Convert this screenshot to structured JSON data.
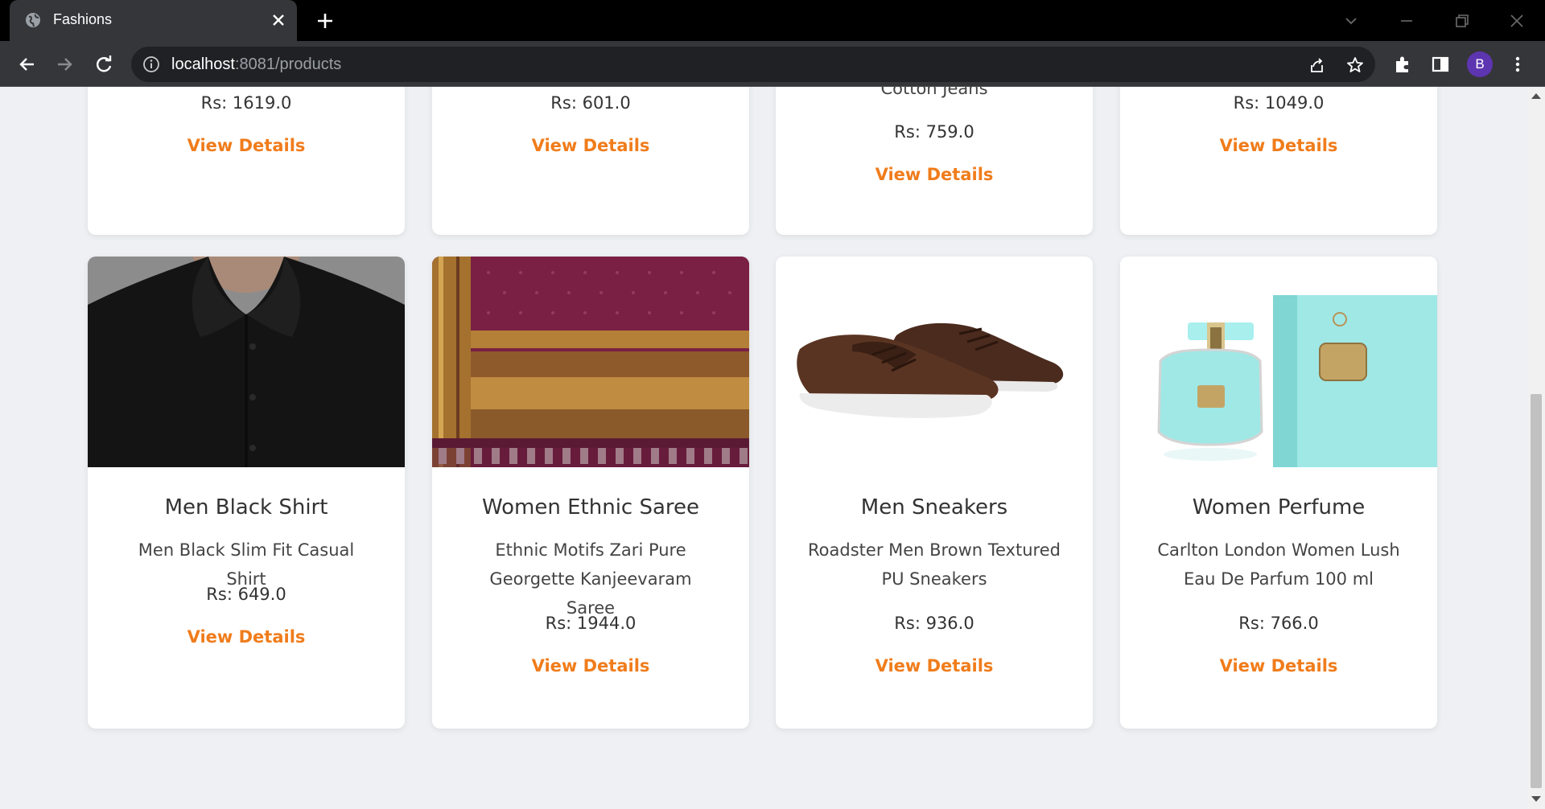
{
  "browser": {
    "tab_title": "Fashions",
    "url_host": "localhost",
    "url_rest": ":8081/products",
    "profile_initial": "B"
  },
  "colors": {
    "accent": "#f07c1b",
    "page_bg": "#eef0f3",
    "card_bg": "#ffffff"
  },
  "top_row": [
    {
      "title": "",
      "description_tail": "",
      "price": "Rs: 1619.0",
      "link": "View Details"
    },
    {
      "title": "",
      "description_tail": "",
      "price": "Rs: 601.0",
      "link": "View Details"
    },
    {
      "title": "",
      "description_tail": "Cotton Jeans",
      "price": "Rs: 759.0",
      "link": "View Details"
    },
    {
      "title": "",
      "description_tail": "",
      "price": "Rs: 1049.0",
      "link": "View Details"
    }
  ],
  "products": [
    {
      "title": "Men Black Shirt",
      "description": "Men Black Slim Fit Casual Shirt",
      "price": "Rs: 649.0",
      "link": "View Details",
      "image": "black-shirt-image"
    },
    {
      "title": "Women Ethnic Saree",
      "description": "Ethnic Motifs Zari Pure Georgette Kanjeevaram Saree",
      "price": "Rs: 1944.0",
      "link": "View Details",
      "image": "saree-image"
    },
    {
      "title": "Men Sneakers",
      "description": "Roadster Men Brown Textured PU Sneakers",
      "price": "Rs: 936.0",
      "link": "View Details",
      "image": "sneakers-image"
    },
    {
      "title": "Women Perfume",
      "description": "Carlton London Women Lush Eau De Parfum 100 ml",
      "price": "Rs: 766.0",
      "link": "View Details",
      "image": "perfume-image"
    }
  ]
}
